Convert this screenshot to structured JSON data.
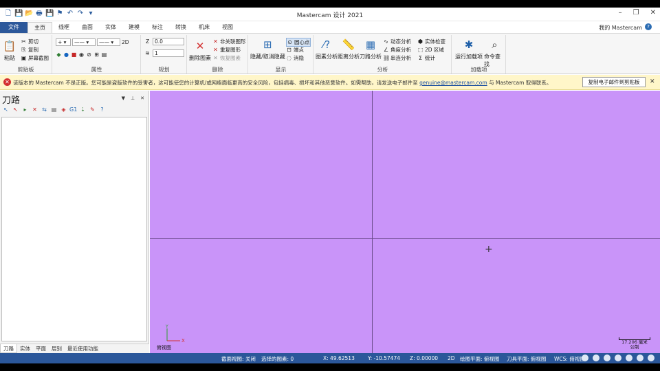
{
  "window": {
    "title": "Mastercam 设计 2021"
  },
  "tabs": [
    "文件",
    "主页",
    "线框",
    "曲面",
    "实体",
    "建模",
    "标注",
    "转换",
    "机床",
    "视图"
  ],
  "my_mastercam": "我的 Mastercam",
  "ribbon": {
    "clipboard": {
      "paste": "粘贴",
      "cut": "剪切",
      "copy": "复制",
      "screenshot": "屏幕截图",
      "label": "剪贴板"
    },
    "attributes": {
      "label": "属性",
      "mode": "2D"
    },
    "plan": {
      "z_label": "Z",
      "z_value": "0.0",
      "level_value": "1",
      "label": "规划"
    },
    "delete": {
      "delete_entity": "删除图素",
      "non_assoc": "非关联图形",
      "repeat": "重复图形",
      "restore": "恢复图素",
      "label": "删除"
    },
    "display": {
      "hide": "隐藏/取消隐藏",
      "center": "圆心点",
      "endpoint": "端点",
      "blank": "消隐",
      "label": "显示"
    },
    "analysis": {
      "entity": "图素分析",
      "distance": "距离分析",
      "toolpath": "刀路分析",
      "dynamic": "动态分析",
      "angle": "角度分析",
      "chain": "串连分析",
      "solid_check": "实体检查",
      "area2d": "2D 区域",
      "stats": "统计",
      "label": "分析"
    },
    "addins": {
      "run": "运行加载项",
      "find": "命令查找",
      "label": "加载项"
    }
  },
  "message": {
    "text_before": "该版本的 Mastercam 不是正版。您可能是盗版软件的受害者，这可能使您的计算机/或网络面临更高的安全风险，包括病毒、损坏和其他恶意软件。如需帮助，请发送电子邮件至 ",
    "link": "genuine@mastercam.com",
    "text_after": " 与 Mastercam 取得联系。",
    "button": "复制电子邮件到剪贴板"
  },
  "panel": {
    "title": "刀路",
    "tabs": [
      "刀路",
      "实体",
      "平面",
      "层别",
      "最近使用功能"
    ]
  },
  "viewport": {
    "view_name": "俯视图",
    "scale_value": "17.206 毫米",
    "scale_unit": "公制",
    "bg_color": "#c994f9"
  },
  "status": {
    "section_view": "截面视图: 关闭",
    "selected": "选择的图素: 0",
    "x": "X:   49.62513",
    "y": "Y:   -10.57474",
    "z": "Z:   0.00000",
    "mode": "2D",
    "cplane": "绘图平面: 俯视图",
    "tplane": "刀具平面: 俯视图",
    "wcs": "WCS: 俯视图"
  }
}
